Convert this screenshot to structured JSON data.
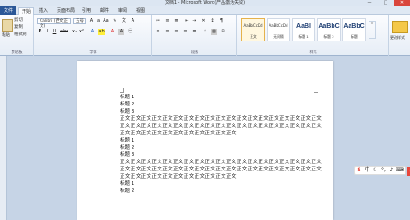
{
  "window": {
    "title": "文档1 - Microsoft Word(产品激活失败)",
    "close_symbol": "✕",
    "minimize_symbol": "—"
  },
  "tabs": [
    {
      "label": "文件"
    },
    {
      "label": "插入"
    },
    {
      "label": "页面布局"
    },
    {
      "label": "引用"
    },
    {
      "label": "邮件"
    },
    {
      "label": "审阅"
    },
    {
      "label": "视图"
    }
  ],
  "active_tab": "开始",
  "ribbon": {
    "clipboard": {
      "label": "剪贴板",
      "paste_label": "粘贴",
      "cut_label": "剪切",
      "copy_label": "复制",
      "painter_label": "格式刷"
    },
    "font": {
      "label": "字体",
      "font_name": "Calibri (西文正文)",
      "font_size": "五号",
      "bold": "B",
      "italic": "I",
      "underline": "U"
    },
    "paragraph": {
      "label": "段落"
    },
    "styles": {
      "label": "样式",
      "items": [
        {
          "sample": "AaBbCcDd",
          "name": "正文",
          "big": false,
          "selected": true
        },
        {
          "sample": "AaBbCcDd",
          "name": "无间隔",
          "big": false,
          "selected": false
        },
        {
          "sample": "AaBl",
          "name": "标题 1",
          "big": true,
          "selected": false
        },
        {
          "sample": "AaBbC",
          "name": "标题 2",
          "big": true,
          "selected": false
        },
        {
          "sample": "AaBbC",
          "name": "标题",
          "big": true,
          "selected": false
        }
      ],
      "change_styles_label": "更改样式"
    }
  },
  "document": {
    "paragraphs": [
      {
        "text": "标题 1",
        "kind": "heading"
      },
      {
        "text": "标题 2",
        "kind": "heading"
      },
      {
        "text": "标题 3",
        "kind": "heading"
      },
      {
        "text": "正文正文正文正文正文正文正文正文正文正文正文正文正文正文正文正文正文正文正文正文正文正文正文正文正文正文正文正文正文正文正文正文正文正文正文正文正文正文正文正文正文正文正文正文正文正文正文正文正文",
        "kind": "body"
      },
      {
        "text": "标题 1",
        "kind": "heading"
      },
      {
        "text": "标题 2",
        "kind": "heading"
      },
      {
        "text": "标题 3",
        "kind": "heading"
      },
      {
        "text": "正文正文正文正文正文正文正文正文正文正文正文正文正文正文正文正文正文正文正文正文正文正文正文正文正文正文正文正文正文正文正文正文正文正文正文正文正文正文正文正文正文正文正文正文正文正文正文正文正文",
        "kind": "body"
      },
      {
        "text": "标题 1",
        "kind": "heading"
      },
      {
        "text": "标题 2",
        "kind": "heading"
      }
    ]
  },
  "ime": {
    "logo": "S",
    "mode": "中",
    "icons": [
      "moon-icon",
      "comma-icon",
      "mic-icon",
      "keyboard-icon"
    ],
    "plus": "+"
  }
}
